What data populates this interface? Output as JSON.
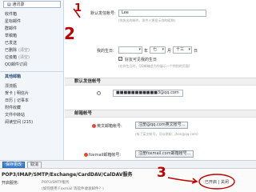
{
  "sidebar": {
    "address_book": "通讯录",
    "items": [
      {
        "label": "收件箱",
        "count": ""
      },
      {
        "label": "星标邮件",
        "count": ""
      },
      {
        "label": "群邮件",
        "count": ""
      },
      {
        "label": "草稿箱",
        "count": ""
      },
      {
        "label": "已发送",
        "count": ""
      },
      {
        "label": "已删除",
        "count": "(清空)"
      },
      {
        "label": "垃圾箱",
        "count": "(清空)"
      },
      {
        "label": "QQ邮件订阅",
        "count": ""
      }
    ],
    "other_header": "其他邮箱",
    "tools": [
      {
        "label": "漂流瓶"
      },
      {
        "label": "贺卡 | 明信片"
      },
      {
        "label": "日历 | 记事本"
      },
      {
        "label": "附件收藏"
      },
      {
        "label": "文件中转站"
      },
      {
        "label": "阅读空间 (215)"
      }
    ]
  },
  "main": {
    "account": {
      "label": "默认发信帐号:",
      "value": "Lee",
      "hint": "(你发出的邮件，发件人将显示你的昵称)"
    },
    "birthday": {
      "label": "我的生日:",
      "year_suffix": "年",
      "month": "七",
      "month_suffix": "月",
      "day": "十三",
      "day_suffix": "日",
      "remind_label": "好友可见我的生日",
      "hint": "(在你生日时，QQ邮箱会为你展示一个特别的页面)"
    },
    "default_sender": {
      "section_title": "默认发信帐号",
      "email": "3@qq.com"
    },
    "email_account": {
      "section_title": "邮箱帐号",
      "english_label": "英文邮箱帐号:",
      "register_button": "注册@qq.com英文帐号...",
      "hint": "(有了英文帐号，可以例如：jhon@qq.com)",
      "foxmail_label": "foxmail邮箱帐号:",
      "foxmail_button": "注册foxmail.com邮箱帐号..."
    },
    "footer": {
      "save_button": "保存更改",
      "cancel_button": "取消"
    }
  },
  "bottom": {
    "title": "POP3/IMAP/SMTP/Exchange/CardDAV/CalDAV服务",
    "service_label": "开启服务:",
    "service_name": "POP3/SMTP服务",
    "description": "(如何使用 Foxmail 等软件收发邮件？)",
    "status": "已开启 | 关闭"
  },
  "annotations": {
    "step1": "1",
    "step2": "2",
    "step3": "3"
  },
  "colors": {
    "annotation": "#c00000",
    "sidebar_bg": "#f2f6fb",
    "accent": "#2a4e7d"
  }
}
